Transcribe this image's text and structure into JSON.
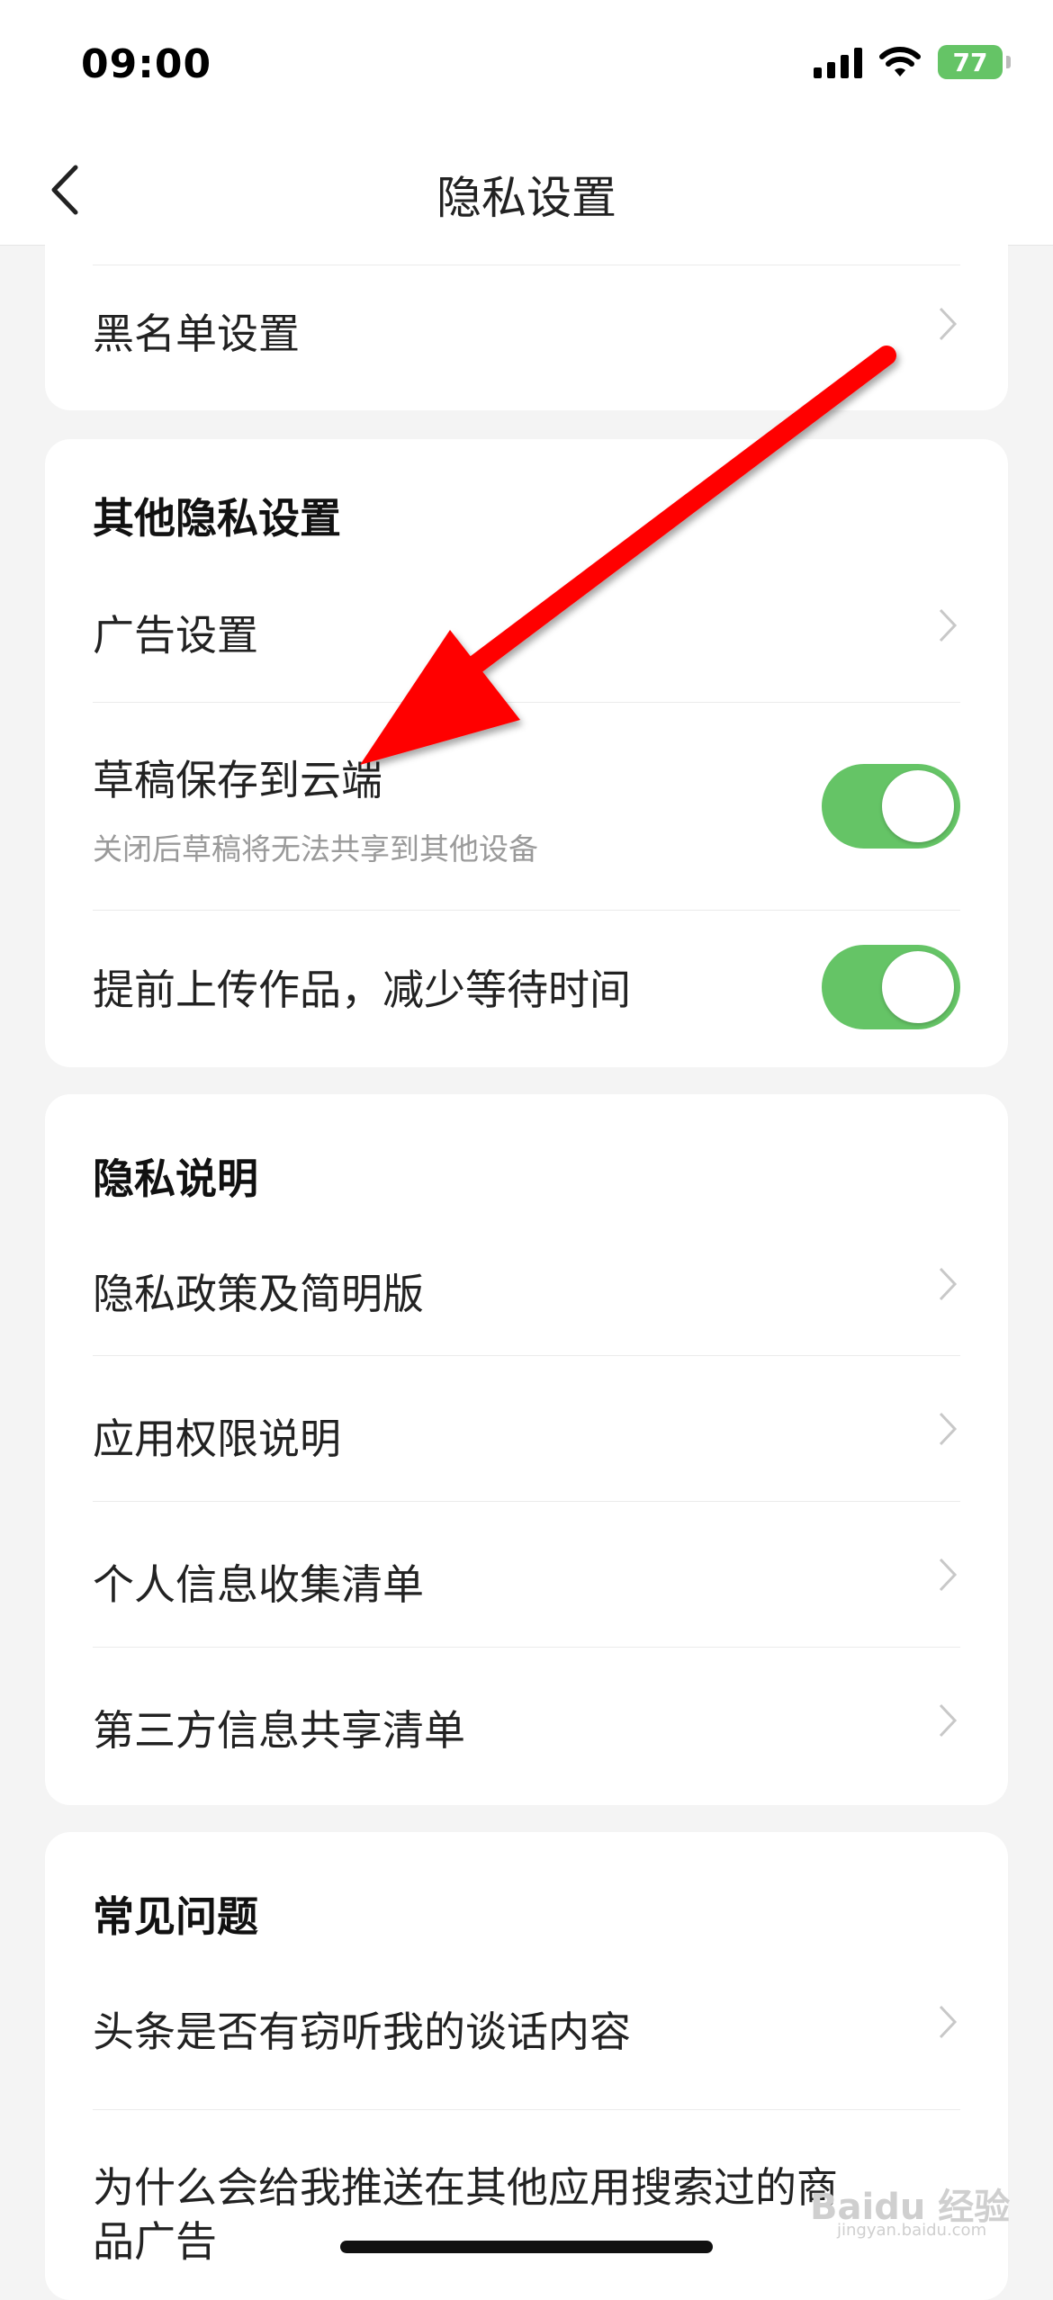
{
  "status_bar": {
    "time": "09:00",
    "battery": "77"
  },
  "nav": {
    "title": "隐私设置",
    "back_icon": "chevron-left-icon"
  },
  "card_blacklist": {
    "items": [
      {
        "label": "黑名单设置"
      }
    ]
  },
  "card_other": {
    "title": "其他隐私设置",
    "items": [
      {
        "label": "广告设置"
      },
      {
        "label": "草稿保存到云端",
        "sub": "关闭后草稿将无法共享到其他设备",
        "toggle_on": true
      },
      {
        "label": "提前上传作品，减少等待时间",
        "toggle_on": true
      }
    ]
  },
  "card_policy": {
    "title": "隐私说明",
    "items": [
      {
        "label": "隐私政策及简明版"
      },
      {
        "label": "应用权限说明"
      },
      {
        "label": "个人信息收集清单"
      },
      {
        "label": "第三方信息共享清单"
      }
    ]
  },
  "card_faq": {
    "title": "常见问题",
    "items": [
      {
        "label": "头条是否有窃听我的谈话内容"
      },
      {
        "label_line1": "为什么会给我推送在其他应用搜索过的商",
        "label_line2": "品广告"
      }
    ]
  },
  "watermark": {
    "text": "Baidu 经验",
    "sub": "jingyan.baidu.com"
  },
  "colors": {
    "toggle_on": "#65c466",
    "annotation_arrow": "#ff0000",
    "background": "#f4f4f4"
  }
}
